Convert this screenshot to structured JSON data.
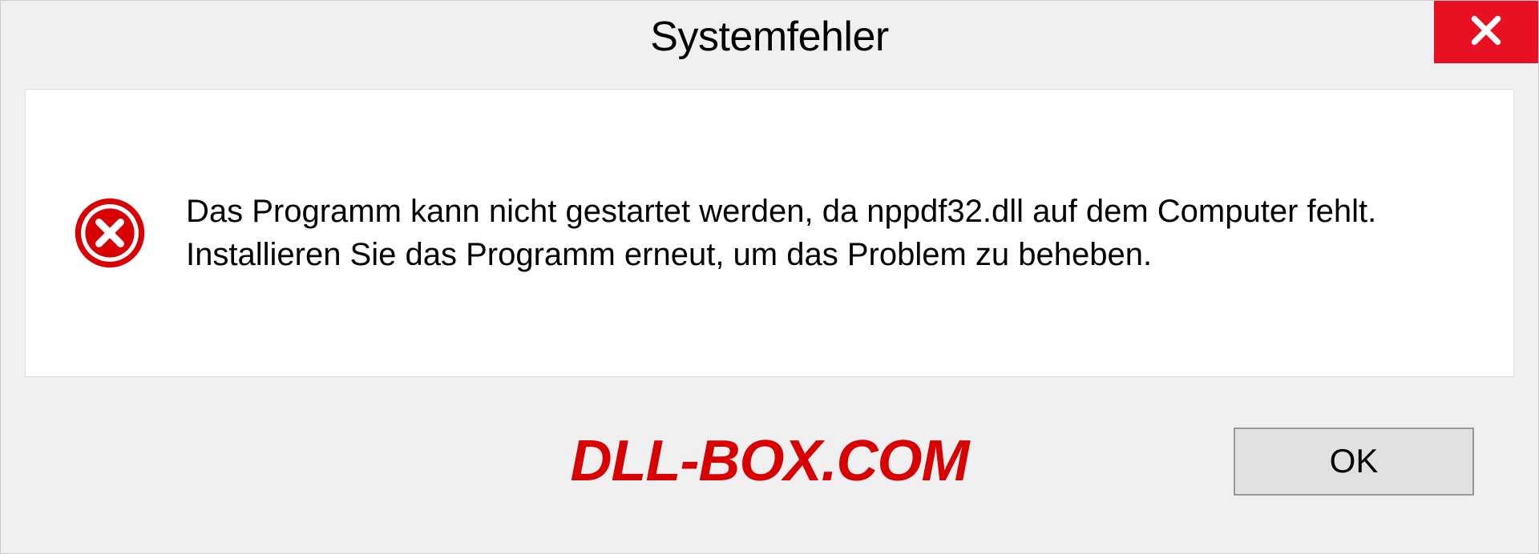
{
  "dialog": {
    "title": "Systemfehler",
    "message": "Das Programm kann nicht gestartet werden, da nppdf32.dll auf dem Computer fehlt. Installieren Sie das Programm erneut, um das Problem zu beheben.",
    "ok_label": "OK"
  },
  "watermark": "DLL-BOX.COM",
  "colors": {
    "close_button_bg": "#e81123",
    "error_icon": "#d80000",
    "watermark": "#d80000"
  }
}
